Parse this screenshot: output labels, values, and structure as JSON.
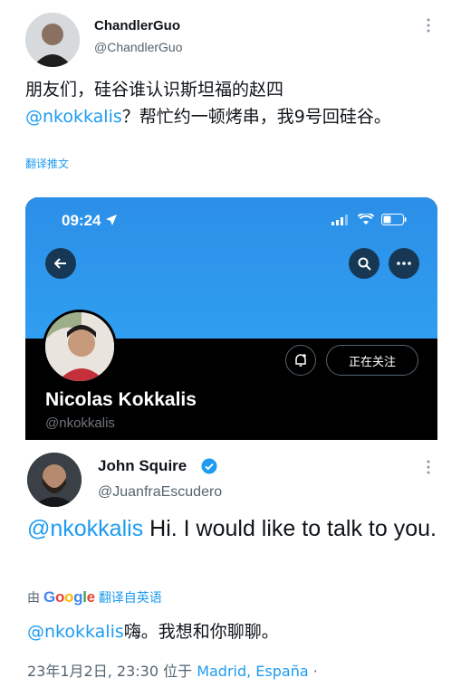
{
  "tweet1": {
    "name": "ChandlerGuo",
    "handle": "@ChandlerGuo",
    "text_line1": "朋友们，硅谷谁认识斯坦福的赵四",
    "mention": "@nkokkalis",
    "text_rest": "？帮忙约一顿烤串，我9号回硅谷。",
    "translate_label": "翻译推文",
    "more_icon": "more-vertical-icon"
  },
  "embedded_profile": {
    "time": "09:24",
    "name": "Nicolas Kokkalis",
    "handle": "@nkokkalis",
    "following_label": "正在关注",
    "banner_color": "#2f9ef0"
  },
  "tweet2": {
    "name": "John Squire",
    "handle": "@JuanfraEscudero",
    "mention": "@nkokkalis",
    "text": " Hi. I would like to talk to you.",
    "translated_by": "由",
    "google_letters": [
      "G",
      "o",
      "o",
      "g",
      "l",
      "e"
    ],
    "translate_label": "翻译自英语",
    "translated_mention": "@nkokkalis",
    "translated_text": "嗨。我想和你聊聊。",
    "timestamp": "23年1月2日, 23:30 位于",
    "location": "Madrid, España",
    "meta_suffix": " ·"
  }
}
